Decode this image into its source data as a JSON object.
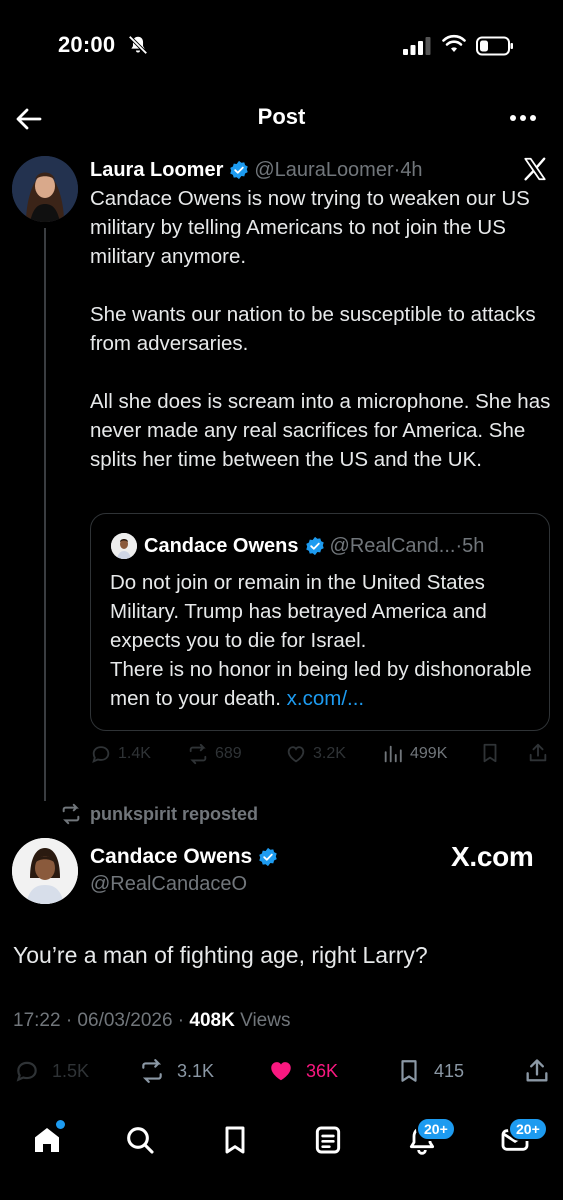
{
  "status_bar": {
    "time": "20:00"
  },
  "header": {
    "title": "Post"
  },
  "quoted_post": {
    "author_name": "Laura Loomer",
    "handle": "@LauraLoomer",
    "time": "4h",
    "body": [
      "Candace Owens is now trying to weaken our US military by telling Americans to not join the US military anymore.",
      "She wants our nation to be susceptible to attacks from adversaries.",
      "All she does is scream into a microphone. She has never made any real sacrifices for America. She splits her time between the US and the UK."
    ],
    "embedded_quote": {
      "author_name": "Candace Owens",
      "handle": "@RealCand...",
      "time": "5h",
      "line1": "Do not join or remain in the United States Military. Trump has betrayed America and expects you to die for Israel.",
      "line2": "There is no honor in being led by dishonorable men to your death.",
      "link": "x.com/..."
    },
    "actions": {
      "replies": "1.4K",
      "reposts": "689",
      "likes": "3.2K",
      "views": "499K"
    }
  },
  "repost_label": "punkspirit reposted",
  "main_post": {
    "author_name": "Candace Owens",
    "handle": "@RealCandaceO",
    "watermark": "X.com",
    "text": "You’re a man of fighting age, right Larry?",
    "timestamp": "17:22 · 06/03/2026 · ",
    "views_count": "408K",
    "views_label": "Views",
    "actions": {
      "replies": "1.5K",
      "reposts": "3.1K",
      "likes": "36K",
      "bookmarks": "415"
    }
  },
  "tab_bar": {
    "notifications_badge": "20+",
    "messages_badge": "20+"
  },
  "colors": {
    "accent": "#1d9bf0",
    "like": "#f91880",
    "muted": "#71767b",
    "background": "#000000"
  }
}
